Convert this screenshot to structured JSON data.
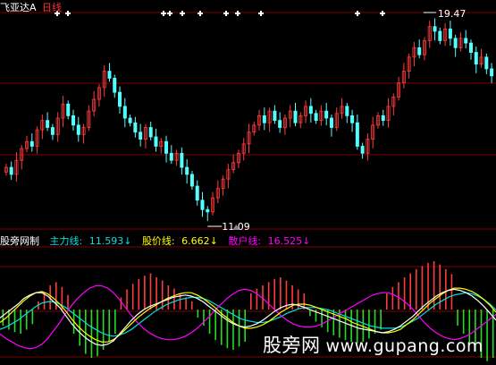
{
  "price_header": {
    "stock_name": "飞亚达A",
    "period": "日线"
  },
  "price_annotations": {
    "high": "19.47",
    "low": "11.09"
  },
  "indicator_header": {
    "title": "股旁网制",
    "main_force_label": "主力线:",
    "main_force_value": "11.593",
    "stock_price_label": "股价线:",
    "stock_price_value": "6.662",
    "retail_label": "散户线:",
    "retail_value": "16.525",
    "arrow": "↓"
  },
  "watermark": {
    "cn": "股旁网",
    "url": "www.gupang.com"
  },
  "colors": {
    "up_candle": "#ff3c3c",
    "down_candle": "#54ffff",
    "main_force": "#ffffff",
    "stock_price": "#ffff00",
    "retail": "#ff00ff",
    "cyan_line": "#00e0e0",
    "grid": "#800000",
    "header_red": "#ff3232"
  },
  "signal_icons": "white-cross-marker",
  "chart_data": [
    {
      "type": "candlestick",
      "title": "飞亚达A 日线",
      "annotations": [
        {
          "text": "19.47",
          "kind": "period-high"
        },
        {
          "text": "11.09",
          "kind": "period-low"
        }
      ],
      "close": [
        13.2,
        12.9,
        13.5,
        14.0,
        14.3,
        14.1,
        14.8,
        15.2,
        14.9,
        14.6,
        15.3,
        15.9,
        15.4,
        15.0,
        14.6,
        14.9,
        15.6,
        16.1,
        16.6,
        17.3,
        17.0,
        16.4,
        15.8,
        15.3,
        15.1,
        14.7,
        14.4,
        14.9,
        14.5,
        14.1,
        14.3,
        13.8,
        13.5,
        13.8,
        13.2,
        12.9,
        12.4,
        11.8,
        11.4,
        11.3,
        11.9,
        12.3,
        12.7,
        13.1,
        13.4,
        13.8,
        14.2,
        14.7,
        15.0,
        15.4,
        15.1,
        15.6,
        15.2,
        14.9,
        15.3,
        15.6,
        15.1,
        15.4,
        15.8,
        15.5,
        15.2,
        15.6,
        15.3,
        14.9,
        15.5,
        15.8,
        15.4,
        15.1,
        14.1,
        13.8,
        14.4,
        15.0,
        15.4,
        15.2,
        15.8,
        16.2,
        16.8,
        17.3,
        17.9,
        18.3,
        18.0,
        18.6,
        19.2,
        19.0,
        18.6,
        19.1,
        18.7,
        18.3,
        18.7,
        18.5,
        18.1,
        17.6,
        17.9,
        17.4,
        17.1
      ]
    },
    {
      "type": "line",
      "series": [
        {
          "name": "主力线",
          "color": "white",
          "last": 11.593
        },
        {
          "name": "股价线",
          "color": "yellow",
          "last": 6.662
        },
        {
          "name": "散户线",
          "color": "magenta",
          "last": 16.525
        }
      ],
      "main_force": [
        38,
        42,
        46,
        50,
        55,
        58,
        60,
        60,
        57,
        52,
        47,
        40,
        33,
        27,
        22,
        18,
        15,
        14,
        15,
        18,
        24,
        30,
        36,
        41,
        45,
        48,
        50,
        52,
        54,
        56,
        57,
        58,
        57,
        55,
        52,
        48,
        44,
        40,
        36,
        33,
        31,
        30,
        31,
        33,
        36,
        40,
        44,
        47,
        49,
        50,
        49,
        47,
        45,
        43,
        41,
        39,
        37,
        35,
        33,
        31,
        29,
        28,
        27,
        26,
        25,
        26,
        28,
        31,
        35,
        39,
        44,
        49,
        53,
        57,
        60,
        62,
        63,
        62,
        60,
        57,
        53,
        48,
        42,
        36
      ],
      "stock_price": [
        34,
        38,
        43,
        48,
        53,
        57,
        60,
        61,
        59,
        55,
        50,
        44,
        37,
        31,
        26,
        22,
        19,
        17,
        17,
        19,
        23,
        28,
        33,
        38,
        42,
        46,
        49,
        52,
        55,
        57,
        59,
        60,
        60,
        58,
        55,
        51,
        47,
        42,
        38,
        34,
        31,
        29,
        29,
        30,
        32,
        35,
        39,
        43,
        46,
        49,
        50,
        50,
        49,
        47,
        45,
        43,
        41,
        39,
        37,
        34,
        32,
        30,
        28,
        26,
        25,
        25,
        26,
        28,
        32,
        36,
        41,
        46,
        51,
        55,
        59,
        62,
        64,
        64,
        63,
        61,
        58,
        54,
        49,
        43
      ],
      "retail": [
        24,
        20,
        17,
        14,
        12,
        11,
        12,
        15,
        20,
        27,
        34,
        42,
        49,
        55,
        60,
        64,
        66,
        66,
        64,
        60,
        54,
        47,
        40,
        34,
        29,
        25,
        22,
        20,
        19,
        19,
        20,
        22,
        25,
        29,
        34,
        39,
        45,
        50,
        55,
        59,
        62,
        63,
        62,
        59,
        55,
        50,
        45,
        40,
        36,
        33,
        31,
        30,
        30,
        31,
        33,
        36,
        39,
        42,
        45,
        48,
        51,
        54,
        57,
        59,
        60,
        60,
        58,
        55,
        51,
        46,
        40,
        34,
        29,
        25,
        22,
        20,
        19,
        20,
        22,
        25,
        29,
        33,
        37,
        41
      ],
      "cyan": [
        28,
        30,
        33,
        36,
        40,
        44,
        48,
        51,
        52,
        52,
        50,
        47,
        43,
        39,
        35,
        31,
        28,
        25,
        23,
        22,
        23,
        25,
        28,
        32,
        36,
        40,
        44,
        47,
        50,
        52,
        54,
        55,
        56,
        56,
        55,
        53,
        50,
        47,
        44,
        41,
        38,
        36,
        35,
        34,
        34,
        35,
        37,
        39,
        42,
        44,
        46,
        47,
        47,
        47,
        46,
        45,
        43,
        41,
        39,
        37,
        35,
        33,
        31,
        30,
        29,
        29,
        29,
        30,
        32,
        35,
        38,
        42,
        46,
        50,
        53,
        56,
        58,
        59,
        60,
        59,
        57,
        54,
        50,
        45
      ],
      "histogram": [
        -20,
        -25,
        -28,
        -30,
        -25,
        -18,
        10,
        22,
        30,
        34,
        28,
        18,
        -30,
        -45,
        -55,
        -60,
        -58,
        -50,
        -40,
        -30,
        15,
        25,
        32,
        38,
        42,
        45,
        40,
        36,
        30,
        26,
        20,
        15,
        10,
        -10,
        -20,
        -30,
        -38,
        -44,
        -48,
        -50,
        -46,
        -40,
        20,
        26,
        30,
        34,
        38,
        40,
        36,
        30,
        25,
        20,
        -8,
        -15,
        -22,
        -28,
        -32,
        -35,
        -38,
        -40,
        -42,
        -40,
        -36,
        -30,
        -25,
        20,
        28,
        34,
        40,
        45,
        50,
        54,
        58,
        60,
        56,
        50,
        44,
        -20,
        -30,
        -42,
        -52,
        -60,
        -64,
        -60
      ]
    }
  ]
}
